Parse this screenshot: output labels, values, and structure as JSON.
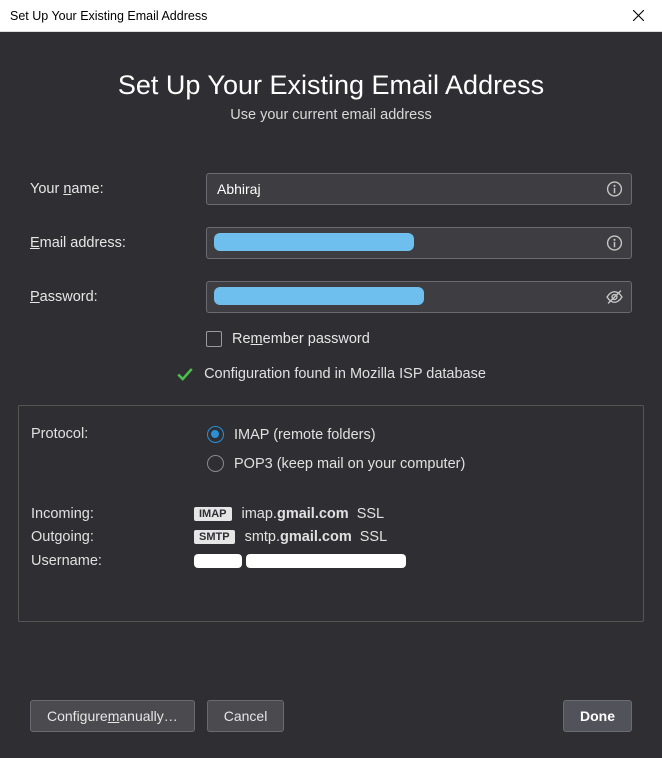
{
  "titlebar": {
    "title": "Set Up Your Existing Email Address"
  },
  "heading": "Set Up Your Existing Email Address",
  "subtitle": "Use your current email address",
  "form": {
    "name_label_pre": "Your ",
    "name_label_u": "n",
    "name_label_post": "ame:",
    "name_value": "Abhiraj",
    "email_label_u": "E",
    "email_label_post": "mail address:",
    "password_label_u": "P",
    "password_label_post": "assword:",
    "remember_label_pre": "Re",
    "remember_label_u": "m",
    "remember_label_post": "ember password"
  },
  "status": "Configuration found in Mozilla ISP database",
  "protocol": {
    "label": "Protocol:",
    "imap": "IMAP (remote folders)",
    "pop3": "POP3 (keep mail on your computer)"
  },
  "servers": {
    "incoming_label": "Incoming:",
    "incoming_badge": "IMAP",
    "incoming_host_pre": "imap.",
    "incoming_host_bold": "gmail.com",
    "incoming_ssl": "SSL",
    "outgoing_label": "Outgoing:",
    "outgoing_badge": "SMTP",
    "outgoing_host_pre": "smtp.",
    "outgoing_host_bold": "gmail.com",
    "outgoing_ssl": "SSL",
    "username_label": "Username:"
  },
  "buttons": {
    "configure_pre": "Configure ",
    "configure_u": "m",
    "configure_post": "anually…",
    "cancel": "Cancel",
    "done": "Done"
  }
}
